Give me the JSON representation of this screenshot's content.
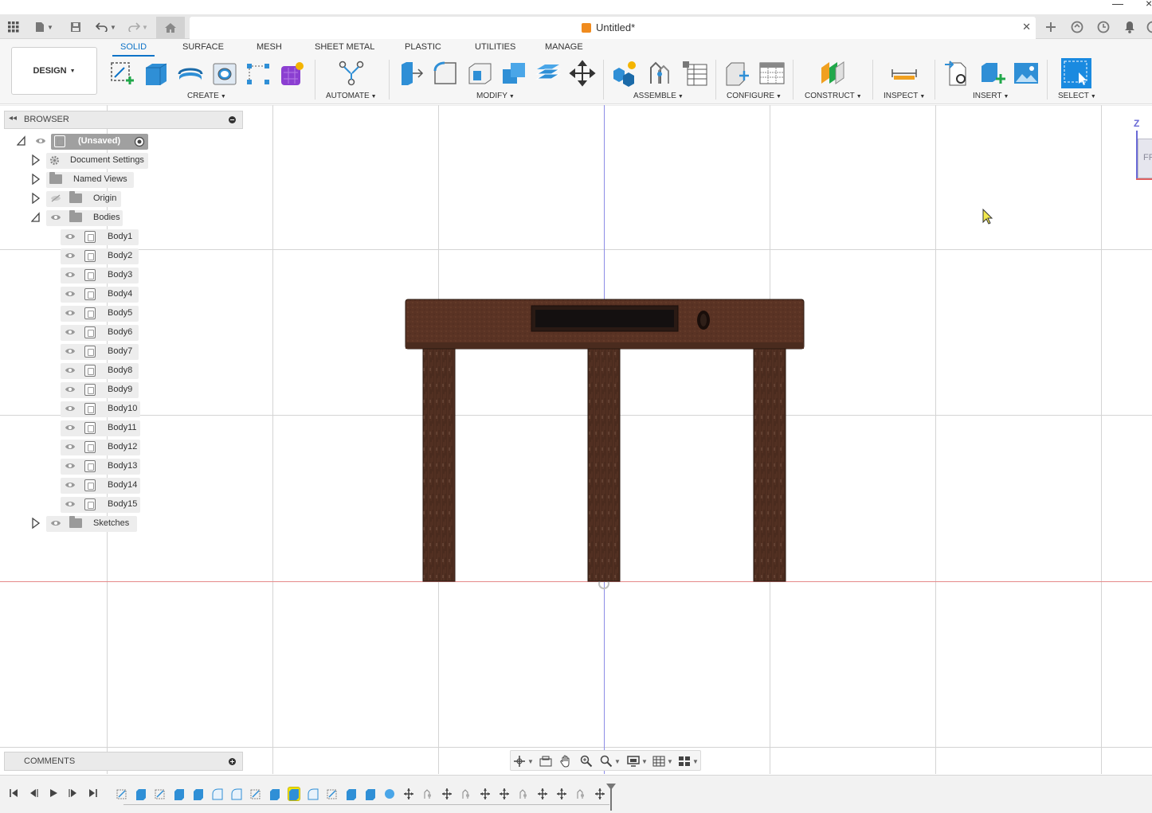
{
  "window": {
    "minimize_glyph": "—",
    "close_glyph": "×"
  },
  "document": {
    "title": "Untitled*"
  },
  "appbar_icons": [
    "grid-menu-icon",
    "file-icon",
    "save-icon",
    "undo-icon",
    "redo-icon",
    "home-icon"
  ],
  "appbar_right_icons": [
    "new-tab-icon",
    "extensions-icon",
    "job-status-icon",
    "notifications-icon"
  ],
  "workspace": {
    "label": "DESIGN"
  },
  "tabs": [
    "SOLID",
    "SURFACE",
    "MESH",
    "SHEET METAL",
    "PLASTIC",
    "UTILITIES",
    "MANAGE"
  ],
  "active_tab": "SOLID",
  "groups": [
    "CREATE",
    "AUTOMATE",
    "MODIFY",
    "ASSEMBLE",
    "CONFIGURE",
    "CONSTRUCT",
    "INSPECT",
    "INSERT",
    "SELECT"
  ],
  "tools": {
    "create": [
      "create-sketch-icon",
      "extrude-icon",
      "revolve-icon",
      "hole-icon",
      "pattern-icon",
      "form-icon"
    ],
    "automate": [
      "automate-icon"
    ],
    "modify": [
      "press-pull-icon",
      "fillet-icon",
      "shell-icon",
      "combine-icon",
      "offset-face-icon",
      "move-icon"
    ],
    "assemble": [
      "new-component-icon",
      "joint-icon",
      "bom-table-icon"
    ],
    "configure": [
      "configure-icon",
      "config-table-icon"
    ],
    "construct": [
      "offset-plane-icon"
    ],
    "inspect": [
      "measure-icon"
    ],
    "insert": [
      "insert-derive-icon",
      "insert-mcmaster-icon",
      "insert-canvas-icon"
    ],
    "select": [
      "select-icon"
    ]
  },
  "browser": {
    "title": "BROWSER",
    "root": "(Unsaved)",
    "nodes": [
      "Document Settings",
      "Named Views",
      "Origin",
      "Bodies"
    ],
    "bodies": [
      "Body1",
      "Body2",
      "Body3",
      "Body4",
      "Body5",
      "Body6",
      "Body7",
      "Body8",
      "Body9",
      "Body10",
      "Body11",
      "Body12",
      "Body13",
      "Body14",
      "Body15"
    ],
    "sketches": "Sketches"
  },
  "comments": {
    "title": "COMMENTS"
  },
  "viewcube": {
    "axis_label": "Z",
    "face_label": "FR"
  },
  "colors": {
    "accent": "#0d73c7",
    "wood": "#5a3324",
    "wood_dark": "#3f2419",
    "x_axis": "#e58a8a",
    "z_axis": "#8c8ce6"
  },
  "nav_icons": [
    "orbit-icon",
    "look-at-icon",
    "pan-icon",
    "zoom-icon",
    "fit-icon",
    "display-settings-icon",
    "grid-settings-icon",
    "viewports-icon"
  ],
  "timeline_controls": [
    "go-to-start-icon",
    "step-back-icon",
    "play-icon",
    "step-forward-icon",
    "go-to-end-icon"
  ],
  "timeline_feature_count": 26
}
